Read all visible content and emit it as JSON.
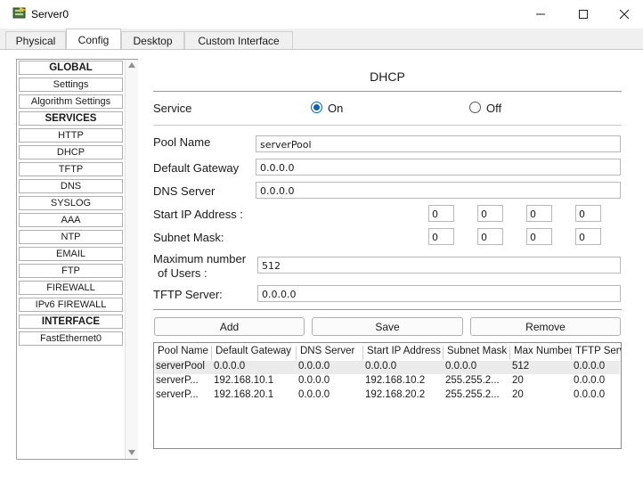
{
  "window": {
    "title": "Server0",
    "minimize": "—",
    "maximize": "☐",
    "close": "✕"
  },
  "tabs": [
    "Physical",
    "Config",
    "Desktop",
    "Custom Interface"
  ],
  "sidebar": {
    "items": [
      {
        "label": "GLOBAL",
        "header": true
      },
      {
        "label": "Settings",
        "header": false
      },
      {
        "label": "Algorithm Settings",
        "header": false
      },
      {
        "label": "SERVICES",
        "header": true
      },
      {
        "label": "HTTP",
        "header": false
      },
      {
        "label": "DHCP",
        "header": false
      },
      {
        "label": "TFTP",
        "header": false
      },
      {
        "label": "DNS",
        "header": false
      },
      {
        "label": "SYSLOG",
        "header": false
      },
      {
        "label": "AAA",
        "header": false
      },
      {
        "label": "NTP",
        "header": false
      },
      {
        "label": "EMAIL",
        "header": false
      },
      {
        "label": "FTP",
        "header": false
      },
      {
        "label": "FIREWALL",
        "header": false
      },
      {
        "label": "IPv6 FIREWALL",
        "header": false
      },
      {
        "label": "INTERFACE",
        "header": true
      },
      {
        "label": "FastEthernet0",
        "header": false
      }
    ]
  },
  "dhcp": {
    "title": "DHCP",
    "service_label": "Service",
    "on_label": "On",
    "off_label": "Off",
    "service_state": "On",
    "pool_name_label": "Pool Name",
    "pool_name": "serverPool",
    "gateway_label": "Default Gateway",
    "gateway": "0.0.0.0",
    "dns_label": "DNS Server",
    "dns": "0.0.0.0",
    "start_ip_label": "Start IP Address :",
    "start_ip": [
      "0",
      "0",
      "0",
      "0"
    ],
    "subnet_label": "Subnet Mask:",
    "subnet": [
      "0",
      "0",
      "0",
      "0"
    ],
    "max_users_label_1": "Maximum number",
    "max_users_label_2": "of Users :",
    "max_users": "512",
    "tftp_label": "TFTP Server:",
    "tftp": "0.0.0.0",
    "add_label": "Add",
    "save_label": "Save",
    "remove_label": "Remove"
  },
  "pool_table": {
    "columns": [
      "Pool Name",
      "Default Gateway",
      "DNS Server",
      "Start IP Address",
      "Subnet Mask",
      "Max Number",
      "TFTP Server"
    ],
    "rows": [
      [
        "serverPool",
        "0.0.0.0",
        "0.0.0.0",
        "0.0.0.0",
        "0.0.0.0",
        "512",
        "0.0.0.0"
      ],
      [
        "serverP...",
        "192.168.10.1",
        "0.0.0.0",
        "192.168.10.2",
        "255.255.2...",
        "20",
        "0.0.0.0"
      ],
      [
        "serverP...",
        "192.168.20.1",
        "0.0.0.0",
        "192.168.20.2",
        "255.255.2...",
        "20",
        "0.0.0.0"
      ]
    ]
  },
  "colors": {
    "accent": "#0067c0",
    "selected_row": "#ebebeb"
  }
}
